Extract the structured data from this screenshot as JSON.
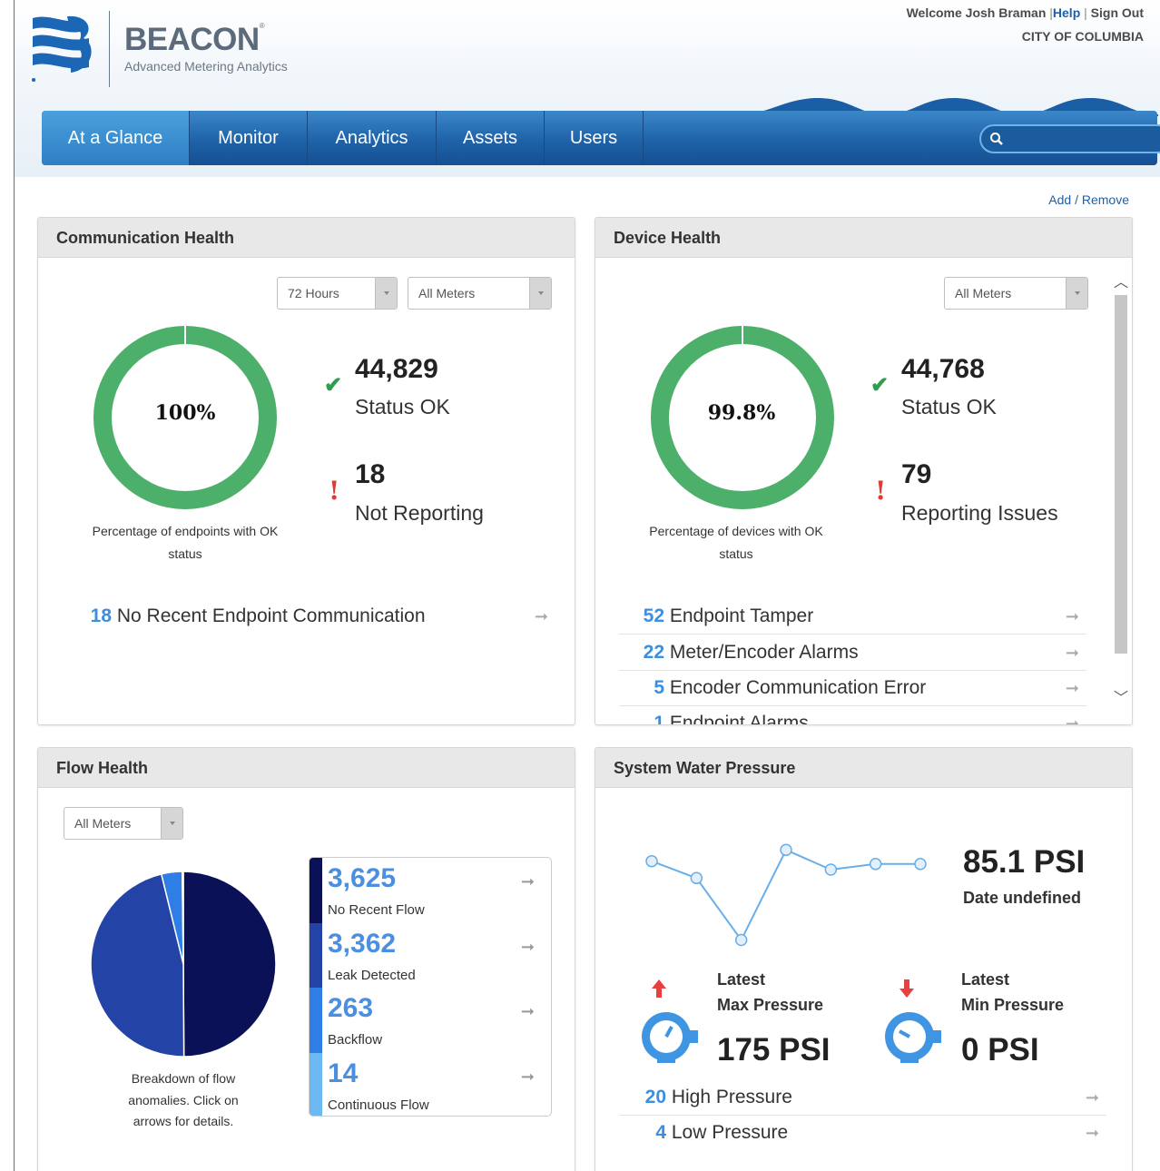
{
  "header": {
    "brand": "BEACON",
    "brand_mark": "®",
    "tagline": "Advanced Metering Analytics",
    "welcome": "Welcome Josh Braman",
    "help": "Help",
    "signout": "Sign Out",
    "city": "CITY OF COLUMBIA"
  },
  "nav": {
    "items": [
      "At a Glance",
      "Monitor",
      "Analytics",
      "Assets",
      "Users"
    ],
    "search_placeholder": ""
  },
  "add_remove": "Add / Remove",
  "comm": {
    "title": "Communication Health",
    "dd1": "72 Hours",
    "dd2": "All Meters",
    "percent_label": "100%",
    "percent_value": 100,
    "caption1": "Percentage of endpoints with OK",
    "caption2": "status",
    "ok_count": "44,829",
    "ok_label": "Status OK",
    "bad_count": "18",
    "bad_label": "Not Reporting",
    "links": [
      {
        "num": "18",
        "label": "No Recent Endpoint Communication"
      }
    ]
  },
  "device": {
    "title": "Device Health",
    "dd1": "All Meters",
    "percent_label": "99.8%",
    "percent_value": 99.8,
    "caption1": "Percentage of devices with OK",
    "caption2": "status",
    "ok_count": "44,768",
    "ok_label": "Status OK",
    "bad_count": "79",
    "bad_label": "Reporting Issues",
    "links": [
      {
        "num": "52",
        "label": "Endpoint Tamper"
      },
      {
        "num": "22",
        "label": "Meter/Encoder Alarms"
      },
      {
        "num": "5",
        "label": "Encoder Communication Error"
      },
      {
        "num": "1",
        "label": "Endpoint Alarms"
      }
    ]
  },
  "flow": {
    "title": "Flow Health",
    "dd1": "All Meters",
    "caption": [
      "Breakdown of flow",
      "anomalies. Click on",
      "arrows for details."
    ],
    "items": [
      {
        "num": "3,625",
        "label": "No Recent Flow",
        "color": "#0b1157",
        "value": 3625
      },
      {
        "num": "3,362",
        "label": "Leak Detected",
        "color": "#2343a6",
        "value": 3362
      },
      {
        "num": "263",
        "label": "Backflow",
        "color": "#2f7ee6",
        "value": 263
      },
      {
        "num": "14",
        "label": "Continuous Flow",
        "color": "#6bb8f2",
        "value": 14
      }
    ]
  },
  "pressure": {
    "title": "System Water Pressure",
    "current": "85.1 PSI",
    "date": "Date undefined",
    "trend": [
      78,
      72,
      50,
      82,
      75,
      77,
      77
    ],
    "max_label1": "Latest",
    "max_label2": "Max Pressure",
    "max_value": "175 PSI",
    "min_label1": "Latest",
    "min_label2": "Min Pressure",
    "min_value": "0 PSI",
    "links": [
      {
        "num": "20",
        "label": "High Pressure"
      },
      {
        "num": "4",
        "label": "Low Pressure"
      }
    ]
  },
  "colors": {
    "ok_green": "#4caf6a",
    "accent_blue": "#3b8ee0",
    "alert_red": "#e23a2f"
  }
}
